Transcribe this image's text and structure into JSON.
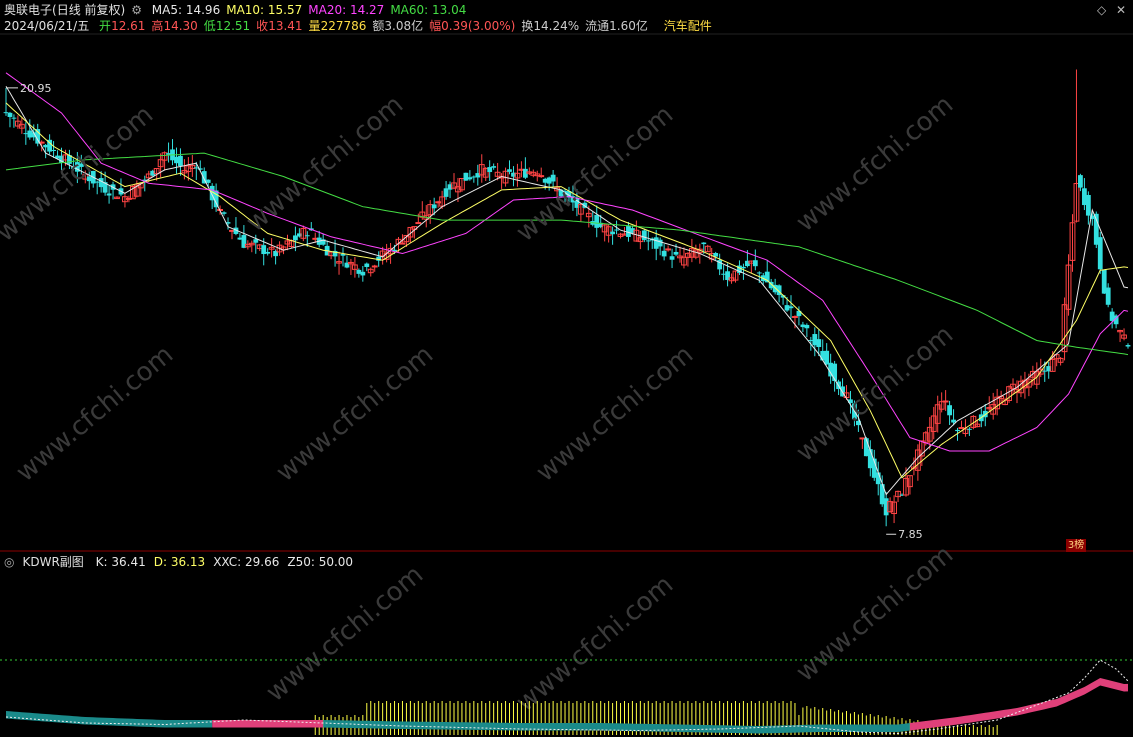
{
  "header": {
    "stock_name": "奥联电子",
    "period": "(日线 前复权)",
    "ma_labels": [
      {
        "text": "MA5: 14.96",
        "color": "#e8e8e8"
      },
      {
        "text": "MA10: 15.57",
        "color": "#ffff66"
      },
      {
        "text": "MA20: 14.27",
        "color": "#ff44ff"
      },
      {
        "text": "MA60: 13.04",
        "color": "#44dd44"
      }
    ],
    "date": "2024/06/21/五",
    "quote": [
      {
        "label": "开",
        "value": "12.61",
        "color": "#ff5555",
        "label_color": "#44dd44"
      },
      {
        "label": "高",
        "value": "14.30",
        "color": "#ff5555",
        "label_color": "#ff5555"
      },
      {
        "label": "低",
        "value": "12.51",
        "color": "#44dd44",
        "label_color": "#44dd44"
      },
      {
        "label": "收",
        "value": "13.41",
        "color": "#ff5555",
        "label_color": "#ff5555"
      },
      {
        "label": "量",
        "value": "227786",
        "color": "#ffdd44",
        "label_color": "#ffdd44"
      },
      {
        "label": "额",
        "value": "3.08亿",
        "color": "#cccccc",
        "label_color": "#cccccc"
      },
      {
        "label": "幅",
        "value": "0.39(3.00%)",
        "color": "#ff5555",
        "label_color": "#ff5555"
      },
      {
        "label": "换",
        "value": "14.24%",
        "color": "#cccccc",
        "label_color": "#cccccc"
      },
      {
        "label": "流通",
        "value": "1.60亿",
        "color": "#cccccc",
        "label_color": "#cccccc"
      }
    ],
    "sector": "汽车配件"
  },
  "sub_indicator": {
    "name": "KDWR副图",
    "values": [
      {
        "text": "K: 36.41",
        "color": "#e8e8e8"
      },
      {
        "text": "D: 36.13",
        "color": "#ffff66"
      },
      {
        "text": "XXC: 29.66",
        "color": "#e8e8e8"
      },
      {
        "text": "Z50: 50.00",
        "color": "#e8e8e8"
      }
    ]
  },
  "annotations": {
    "high_label": "20.95",
    "low_label": "7.85",
    "badge": "3榜",
    "watermark": "www.cfchi.com"
  },
  "colors": {
    "up": "#ff4444",
    "down": "#33e0e0",
    "ma5": "#e8e8e8",
    "ma10": "#ffff66",
    "ma20": "#ff44ff",
    "ma60": "#44dd44",
    "hist_yellow": "#ffff44",
    "band_teal": "#1a8a8a",
    "band_pink": "#e0407a"
  },
  "chart_data": {
    "type": "candlestick",
    "ylim": [
      7.2,
      22.5
    ],
    "high": 20.95,
    "low": 7.85,
    "close_anchors": [
      [
        0,
        20.2
      ],
      [
        8,
        19.4
      ],
      [
        16,
        18.7
      ],
      [
        24,
        18.0
      ],
      [
        30,
        17.7
      ],
      [
        36,
        18.3
      ],
      [
        40,
        19.0
      ],
      [
        45,
        18.5
      ],
      [
        48,
        18.7
      ],
      [
        54,
        17.2
      ],
      [
        60,
        16.3
      ],
      [
        68,
        16.0
      ],
      [
        76,
        16.7
      ],
      [
        82,
        16.0
      ],
      [
        90,
        15.5
      ],
      [
        98,
        16.2
      ],
      [
        106,
        17.2
      ],
      [
        112,
        18.0
      ],
      [
        120,
        18.5
      ],
      [
        126,
        18.3
      ],
      [
        134,
        18.5
      ],
      [
        140,
        17.8
      ],
      [
        150,
        16.8
      ],
      [
        160,
        16.5
      ],
      [
        170,
        15.8
      ],
      [
        176,
        16.2
      ],
      [
        182,
        15.3
      ],
      [
        188,
        15.7
      ],
      [
        200,
        14.0
      ],
      [
        206,
        12.9
      ],
      [
        212,
        11.7
      ],
      [
        218,
        9.7
      ],
      [
        222,
        8.3
      ],
      [
        226,
        8.9
      ],
      [
        232,
        10.5
      ],
      [
        236,
        11.7
      ],
      [
        240,
        10.7
      ],
      [
        246,
        11.1
      ],
      [
        254,
        12.0
      ],
      [
        262,
        12.5
      ],
      [
        266,
        13.0
      ],
      [
        270,
        18.2
      ],
      [
        274,
        17.0
      ],
      [
        278,
        14.3
      ],
      [
        282,
        13.4
      ]
    ],
    "ma_anchors": {
      "ma5": [
        [
          0,
          21
        ],
        [
          10,
          19.0
        ],
        [
          30,
          17.8
        ],
        [
          40,
          18.5
        ],
        [
          48,
          18.7
        ],
        [
          56,
          16.8
        ],
        [
          70,
          16.1
        ],
        [
          80,
          16.4
        ],
        [
          95,
          15.9
        ],
        [
          110,
          17.4
        ],
        [
          125,
          18.3
        ],
        [
          140,
          17.9
        ],
        [
          155,
          16.7
        ],
        [
          175,
          16.0
        ],
        [
          190,
          15.2
        ],
        [
          205,
          13.0
        ],
        [
          215,
          11.1
        ],
        [
          222,
          8.8
        ],
        [
          230,
          9.9
        ],
        [
          240,
          11.0
        ],
        [
          255,
          12.0
        ],
        [
          268,
          13.3
        ],
        [
          274,
          17.3
        ],
        [
          282,
          15.0
        ]
      ],
      "ma10": [
        [
          0,
          20.5
        ],
        [
          12,
          19.2
        ],
        [
          30,
          18.0
        ],
        [
          44,
          18.4
        ],
        [
          54,
          17.7
        ],
        [
          66,
          16.6
        ],
        [
          80,
          16.1
        ],
        [
          95,
          15.8
        ],
        [
          110,
          16.9
        ],
        [
          125,
          17.9
        ],
        [
          140,
          18.0
        ],
        [
          155,
          17.0
        ],
        [
          175,
          16.1
        ],
        [
          192,
          15.2
        ],
        [
          208,
          13.4
        ],
        [
          218,
          11.3
        ],
        [
          226,
          9.3
        ],
        [
          236,
          10.3
        ],
        [
          246,
          11.1
        ],
        [
          260,
          12.3
        ],
        [
          270,
          14.0
        ],
        [
          276,
          15.5
        ],
        [
          282,
          15.6
        ]
      ],
      "ma20": [
        [
          0,
          21.4
        ],
        [
          14,
          20.2
        ],
        [
          24,
          18.7
        ],
        [
          36,
          18.1
        ],
        [
          52,
          17.9
        ],
        [
          66,
          17.2
        ],
        [
          82,
          16.5
        ],
        [
          100,
          16.0
        ],
        [
          116,
          16.6
        ],
        [
          128,
          17.6
        ],
        [
          142,
          17.7
        ],
        [
          158,
          17.3
        ],
        [
          176,
          16.5
        ],
        [
          192,
          15.8
        ],
        [
          206,
          14.6
        ],
        [
          218,
          12.4
        ],
        [
          228,
          10.5
        ],
        [
          238,
          10.1
        ],
        [
          248,
          10.1
        ],
        [
          260,
          10.8
        ],
        [
          268,
          11.8
        ],
        [
          276,
          13.6
        ],
        [
          282,
          14.3
        ]
      ],
      "ma60": [
        [
          0,
          18.5
        ],
        [
          20,
          18.8
        ],
        [
          50,
          19.0
        ],
        [
          70,
          18.3
        ],
        [
          90,
          17.4
        ],
        [
          110,
          17.0
        ],
        [
          140,
          17.0
        ],
        [
          170,
          16.7
        ],
        [
          200,
          16.2
        ],
        [
          225,
          15.2
        ],
        [
          245,
          14.3
        ],
        [
          260,
          13.4
        ],
        [
          270,
          13.2
        ],
        [
          282,
          13.0
        ]
      ]
    },
    "sub_chart": {
      "ylim": [
        0,
        110
      ],
      "z50_line": 50,
      "k_anchors": [
        [
          0,
          12
        ],
        [
          20,
          8
        ],
        [
          40,
          7
        ],
        [
          60,
          10
        ],
        [
          80,
          8
        ],
        [
          100,
          6
        ],
        [
          130,
          4
        ],
        [
          160,
          3
        ],
        [
          180,
          4
        ],
        [
          200,
          6
        ],
        [
          215,
          2
        ],
        [
          225,
          1
        ],
        [
          235,
          4
        ],
        [
          250,
          10
        ],
        [
          262,
          22
        ],
        [
          268,
          28
        ],
        [
          272,
          38
        ],
        [
          276,
          50
        ],
        [
          280,
          44
        ],
        [
          283,
          36
        ]
      ],
      "band_anchors": [
        [
          0,
          12
        ],
        [
          20,
          8
        ],
        [
          40,
          6
        ],
        [
          60,
          6
        ],
        [
          80,
          6
        ],
        [
          100,
          5
        ],
        [
          130,
          4
        ],
        [
          150,
          4
        ],
        [
          170,
          3
        ],
        [
          190,
          2
        ],
        [
          205,
          3
        ],
        [
          225,
          3
        ],
        [
          240,
          8
        ],
        [
          255,
          14
        ],
        [
          265,
          20
        ],
        [
          272,
          28
        ],
        [
          276,
          34
        ],
        [
          282,
          30
        ]
      ]
    }
  }
}
